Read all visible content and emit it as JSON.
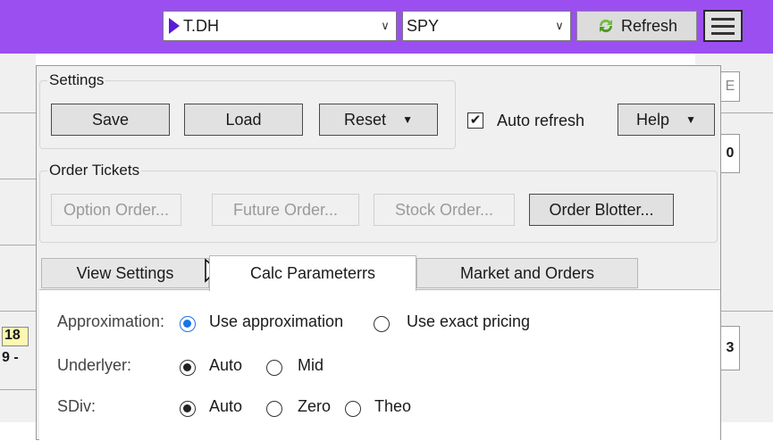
{
  "toolbar": {
    "symbol_combo": "T.DH",
    "underlying_combo": "SPY",
    "refresh_label": "Refresh",
    "accent_color": "#9b4ff0"
  },
  "background": {
    "left_cells": [
      "18",
      "9 -"
    ],
    "right_cells": [
      "E",
      "0",
      "3"
    ]
  },
  "settings": {
    "title": "Settings",
    "save": "Save",
    "load": "Load",
    "reset": "Reset",
    "auto_refresh": "Auto refresh",
    "auto_refresh_checked": true,
    "help": "Help"
  },
  "order_tickets": {
    "title": "Order Tickets",
    "option_order": "Option Order...",
    "future_order": "Future Order...",
    "stock_order": "Stock Order...",
    "order_blotter": "Order Blotter..."
  },
  "tabs": [
    {
      "label": "View Settings",
      "active": false
    },
    {
      "label": "Calc Parameterrs",
      "active": true
    },
    {
      "label": "Market and Orders",
      "active": false
    }
  ],
  "calc": {
    "approximation": {
      "label": "Approximation:",
      "options": [
        "Use approximation",
        "Use exact pricing"
      ],
      "selected": "Use approximation"
    },
    "underlyer": {
      "label": "Underlyer:",
      "options": [
        "Auto",
        "Mid"
      ],
      "selected": "Auto"
    },
    "sdiv": {
      "label": "SDiv:",
      "options": [
        "Auto",
        "Zero",
        "Theo"
      ],
      "selected": "Auto"
    }
  }
}
